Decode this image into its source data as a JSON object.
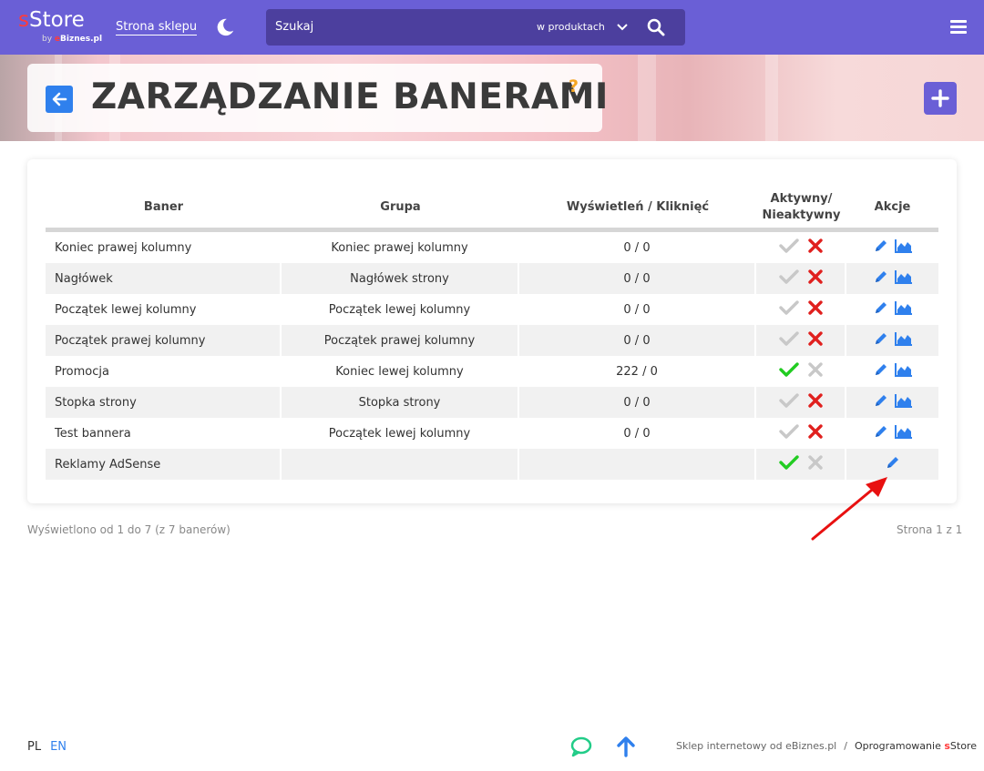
{
  "topbar": {
    "logo_prefix": "s",
    "logo_text": "Store",
    "logo_by": "by",
    "logo_by_e": "e",
    "logo_by_brand": "Biznes.pl",
    "shop_link": "Strona sklepu",
    "search_placeholder": "Szukaj",
    "search_scope": "w produktach",
    "bg_color": "#6a5fd6"
  },
  "header": {
    "title": "ZARZĄDZANIE BANERAMI",
    "help": "?"
  },
  "table": {
    "headers": {
      "banner": "Baner",
      "group": "Grupa",
      "views_clicks": "Wyświetleń / Kliknięć",
      "active_line1": "Aktywny/",
      "active_line2": "Nieaktywny",
      "actions": "Akcje"
    },
    "rows": [
      {
        "name": "Koniec prawej kolumny",
        "group": "Koniec prawej kolumny",
        "stats": "0 / 0",
        "active": false,
        "has_stats": true
      },
      {
        "name": "Nagłówek",
        "group": "Nagłówek strony",
        "stats": "0 / 0",
        "active": false,
        "has_stats": true
      },
      {
        "name": "Początek lewej kolumny",
        "group": "Początek lewej kolumny",
        "stats": "0 / 0",
        "active": false,
        "has_stats": true
      },
      {
        "name": "Początek prawej kolumny",
        "group": "Początek prawej kolumny",
        "stats": "0 / 0",
        "active": false,
        "has_stats": true
      },
      {
        "name": "Promocja",
        "group": "Koniec lewej kolumny",
        "stats": "222 / 0",
        "active": true,
        "has_stats": true
      },
      {
        "name": "Stopka strony",
        "group": "Stopka strony",
        "stats": "0 / 0",
        "active": false,
        "has_stats": true
      },
      {
        "name": "Test bannera",
        "group": "Początek lewej kolumny",
        "stats": "0 / 0",
        "active": false,
        "has_stats": true
      },
      {
        "name": "Reklamy AdSense",
        "group": "",
        "stats": "",
        "active": true,
        "has_stats": false
      }
    ]
  },
  "pagination": {
    "info": "Wyświetlono od 1 do 7 (z 7 banerów)",
    "page": "Strona 1 z 1"
  },
  "footer": {
    "lang_pl": "PL",
    "lang_en": "EN",
    "credit_left": "Sklep internetowy od eBiznes.pl",
    "separator": "/",
    "credit_right_prefix": "Oprogramowanie ",
    "credit_right_s": "s",
    "credit_right_brand": "Store"
  },
  "colors": {
    "accent": "#6a5fd6",
    "link_blue": "#2f80ed",
    "active_green": "#22cc22",
    "inactive_red": "#e0201e",
    "muted_gray": "#c8c8c8",
    "help_orange": "#f5a623",
    "annotation_red": "#e81010"
  },
  "icons": {
    "moon": "moon-icon",
    "search": "search-icon",
    "chevron": "chevron-down-icon",
    "menu": "hamburger-menu-icon",
    "back": "arrow-left-icon",
    "add": "plus-icon",
    "edit": "pencil-icon",
    "stats": "area-chart-icon",
    "check": "check-icon",
    "cross": "x-icon",
    "chat": "chat-bubble-icon",
    "scroll_up": "arrow-up-icon"
  }
}
